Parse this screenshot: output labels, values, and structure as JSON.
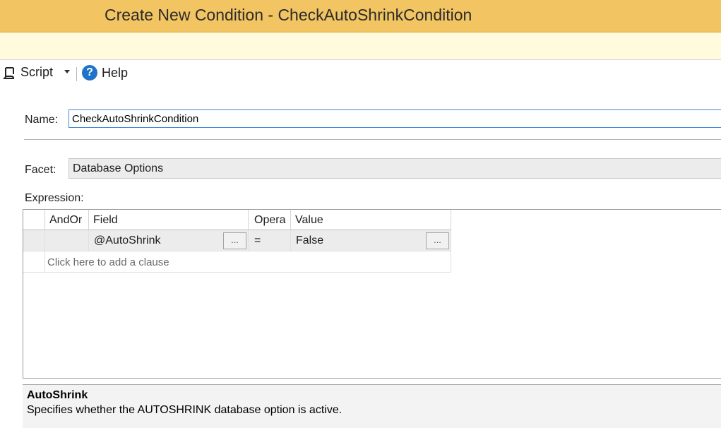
{
  "window": {
    "title": "Create New Condition - CheckAutoShrinkCondition"
  },
  "toolbar": {
    "script_label": "Script",
    "help_label": "Help"
  },
  "form": {
    "name_label": "Name:",
    "name_value": "CheckAutoShrinkCondition",
    "facet_label": "Facet:",
    "facet_value": "Database Options",
    "expression_label": "Expression:"
  },
  "grid": {
    "columns": [
      "AndOr",
      "Field",
      "Opera",
      "Value"
    ],
    "rows": [
      {
        "andor": "",
        "field": "@AutoShrink",
        "operator": "=",
        "value": "False"
      }
    ],
    "ellipsis": "...",
    "add_clause": "Click here to add a clause"
  },
  "description": {
    "title": "AutoShrink",
    "text": "Specifies whether the AUTOSHRINK database option is active."
  },
  "colors": {
    "title_bar": "#f2c462",
    "info_bar": "#fffbdc",
    "focus_border": "#3b8ad9",
    "help_icon": "#1f73c9"
  },
  "icons": {
    "script": "script-icon",
    "help": "help-icon",
    "dropdown": "chevron-down-icon"
  }
}
